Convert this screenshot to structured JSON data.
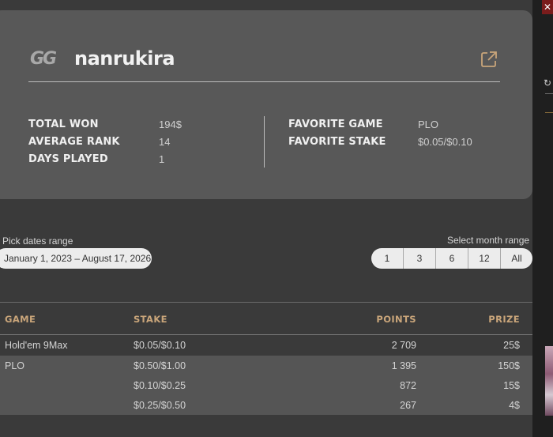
{
  "profile": {
    "logo_text": "GG",
    "username": "nanrukira",
    "stats_left": [
      {
        "label": "TOTAL WON",
        "value": "194$"
      },
      {
        "label": "AVERAGE RANK",
        "value": "14"
      },
      {
        "label": "DAYS PLAYED",
        "value": "1"
      }
    ],
    "stats_right": [
      {
        "label": "FAVORITE GAME",
        "value": "PLO"
      },
      {
        "label": "FAVORITE STAKE",
        "value": "$0.05/$0.10"
      }
    ]
  },
  "filters": {
    "dates_label": "Pick dates range",
    "dates_value": "January 1, 2023 – August 17, 2026",
    "month_label": "Select month range",
    "month_options": [
      "1",
      "3",
      "6",
      "12",
      "All"
    ]
  },
  "table": {
    "headers": {
      "game": "GAME",
      "stake": "STAKE",
      "points": "POINTS",
      "prize": "PRIZE"
    },
    "rows": [
      {
        "game": "Hold'em 9Max",
        "stake": "$0.05/$0.10",
        "points": "2 709",
        "prize": "25$"
      },
      {
        "game": "PLO",
        "stake": "$0.50/$1.00",
        "points": "1 395",
        "prize": "150$"
      },
      {
        "game": "",
        "stake": "$0.10/$0.25",
        "points": "872",
        "prize": "15$"
      },
      {
        "game": "",
        "stake": "$0.25/$0.50",
        "points": "267",
        "prize": "4$"
      }
    ]
  },
  "browser_edge": {
    "close_glyph": "✕",
    "refresh_glyph": "↻"
  },
  "colors": {
    "accent_header": "#c9a57a",
    "card_bg": "#585858",
    "page_bg": "#3a3a3a"
  }
}
